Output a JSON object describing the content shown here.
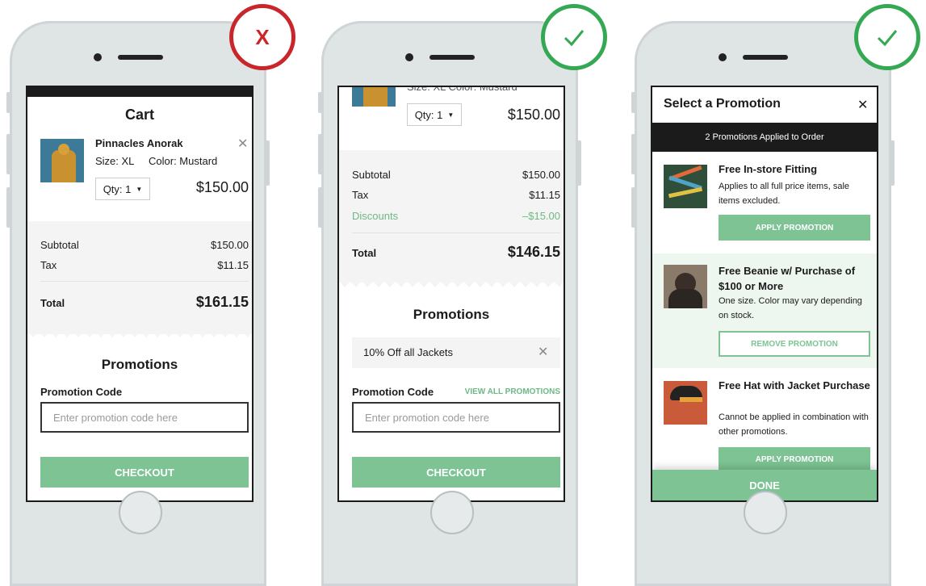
{
  "colors": {
    "accent": "#7dc393",
    "wrong": "#c9262b",
    "right": "#35a853",
    "dark": "#1b1b1b"
  },
  "badges": {
    "wrong_symbol": "X",
    "check_icon": "check-icon"
  },
  "screen1": {
    "title": "Cart",
    "product": {
      "name": "Pinnacles Anorak",
      "size": "Size: XL",
      "color": "Color: Mustard",
      "qty": "Qty: 1",
      "price": "$150.00"
    },
    "subtotal_label": "Subtotal",
    "subtotal_value": "$150.00",
    "tax_label": "Tax",
    "tax_value": "$11.15",
    "total_label": "Total",
    "total_value": "$161.15",
    "promotions_title": "Promotions",
    "promo_code_label": "Promotion Code",
    "promo_placeholder": "Enter promotion code here",
    "checkout_label": "CHECKOUT"
  },
  "screen2": {
    "partial_meta": "Size: XL    Color: Mustard",
    "qty": "Qty: 1",
    "price": "$150.00",
    "subtotal_label": "Subtotal",
    "subtotal_value": "$150.00",
    "tax_label": "Tax",
    "tax_value": "$11.15",
    "discounts_label": "Discounts",
    "discounts_value": "–$15.00",
    "total_label": "Total",
    "total_value": "$146.15",
    "promotions_title": "Promotions",
    "applied_promo": "10% Off all Jackets",
    "promo_code_label": "Promotion Code",
    "view_all_label": "VIEW ALL PROMOTIONS",
    "promo_placeholder": "Enter promotion code here",
    "checkout_label": "CHECKOUT"
  },
  "screen3": {
    "title": "Select a Promotion",
    "applied_banner": "2 Promotions Applied to Order",
    "promos": [
      {
        "title": "Free In-store Fitting",
        "desc": "Applies to all full price items, sale items excluded.",
        "action": "APPLY PROMOTION"
      },
      {
        "title": "Free Beanie w/ Purchase of $100 or More",
        "desc": "One size. Color may vary depending on stock.",
        "action": "REMOVE PROMOTION"
      },
      {
        "title": "Free Hat with Jacket Purchase",
        "desc": "Cannot be applied in combination with other promotions.",
        "action": "APPLY PROMOTION"
      }
    ],
    "done_label": "DONE"
  }
}
